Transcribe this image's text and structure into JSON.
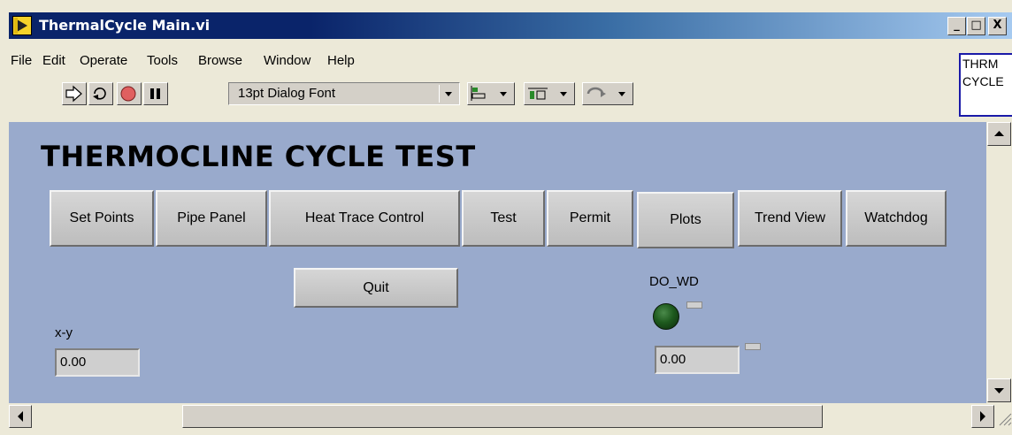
{
  "window": {
    "title": "ThermalCycle Main.vi",
    "controls": {
      "minimize": "_",
      "maximize": "□",
      "close": "X"
    }
  },
  "menu": [
    "File",
    "Edit",
    "Operate",
    "Tools",
    "Browse",
    "Window",
    "Help"
  ],
  "vi_label": {
    "line1": "THRM",
    "line2": "CYCLE"
  },
  "toolbar": {
    "font_select": "13pt Dialog Font",
    "buttons": [
      "run-arrow-icon",
      "run-continuous-icon",
      "abort-icon",
      "pause-icon",
      "align-objects-icon",
      "distribute-objects-icon",
      "reorder-icon"
    ]
  },
  "panel": {
    "title": "THERMOCLINE CYCLE TEST",
    "nav_buttons": [
      "Set Points",
      "Pipe Panel",
      "Heat Trace Control",
      "Test",
      "Permit",
      "Plots",
      "Trend View",
      "Watchdog"
    ],
    "quit_label": "Quit",
    "xy": {
      "label": "x-y",
      "value": "0.00"
    },
    "do_wd": {
      "label": "DO_WD",
      "value": "0.00"
    }
  },
  "colors": {
    "panel_bg": "#99aacc",
    "titlebar": "#0a246a",
    "led": "#1e5a1e"
  }
}
